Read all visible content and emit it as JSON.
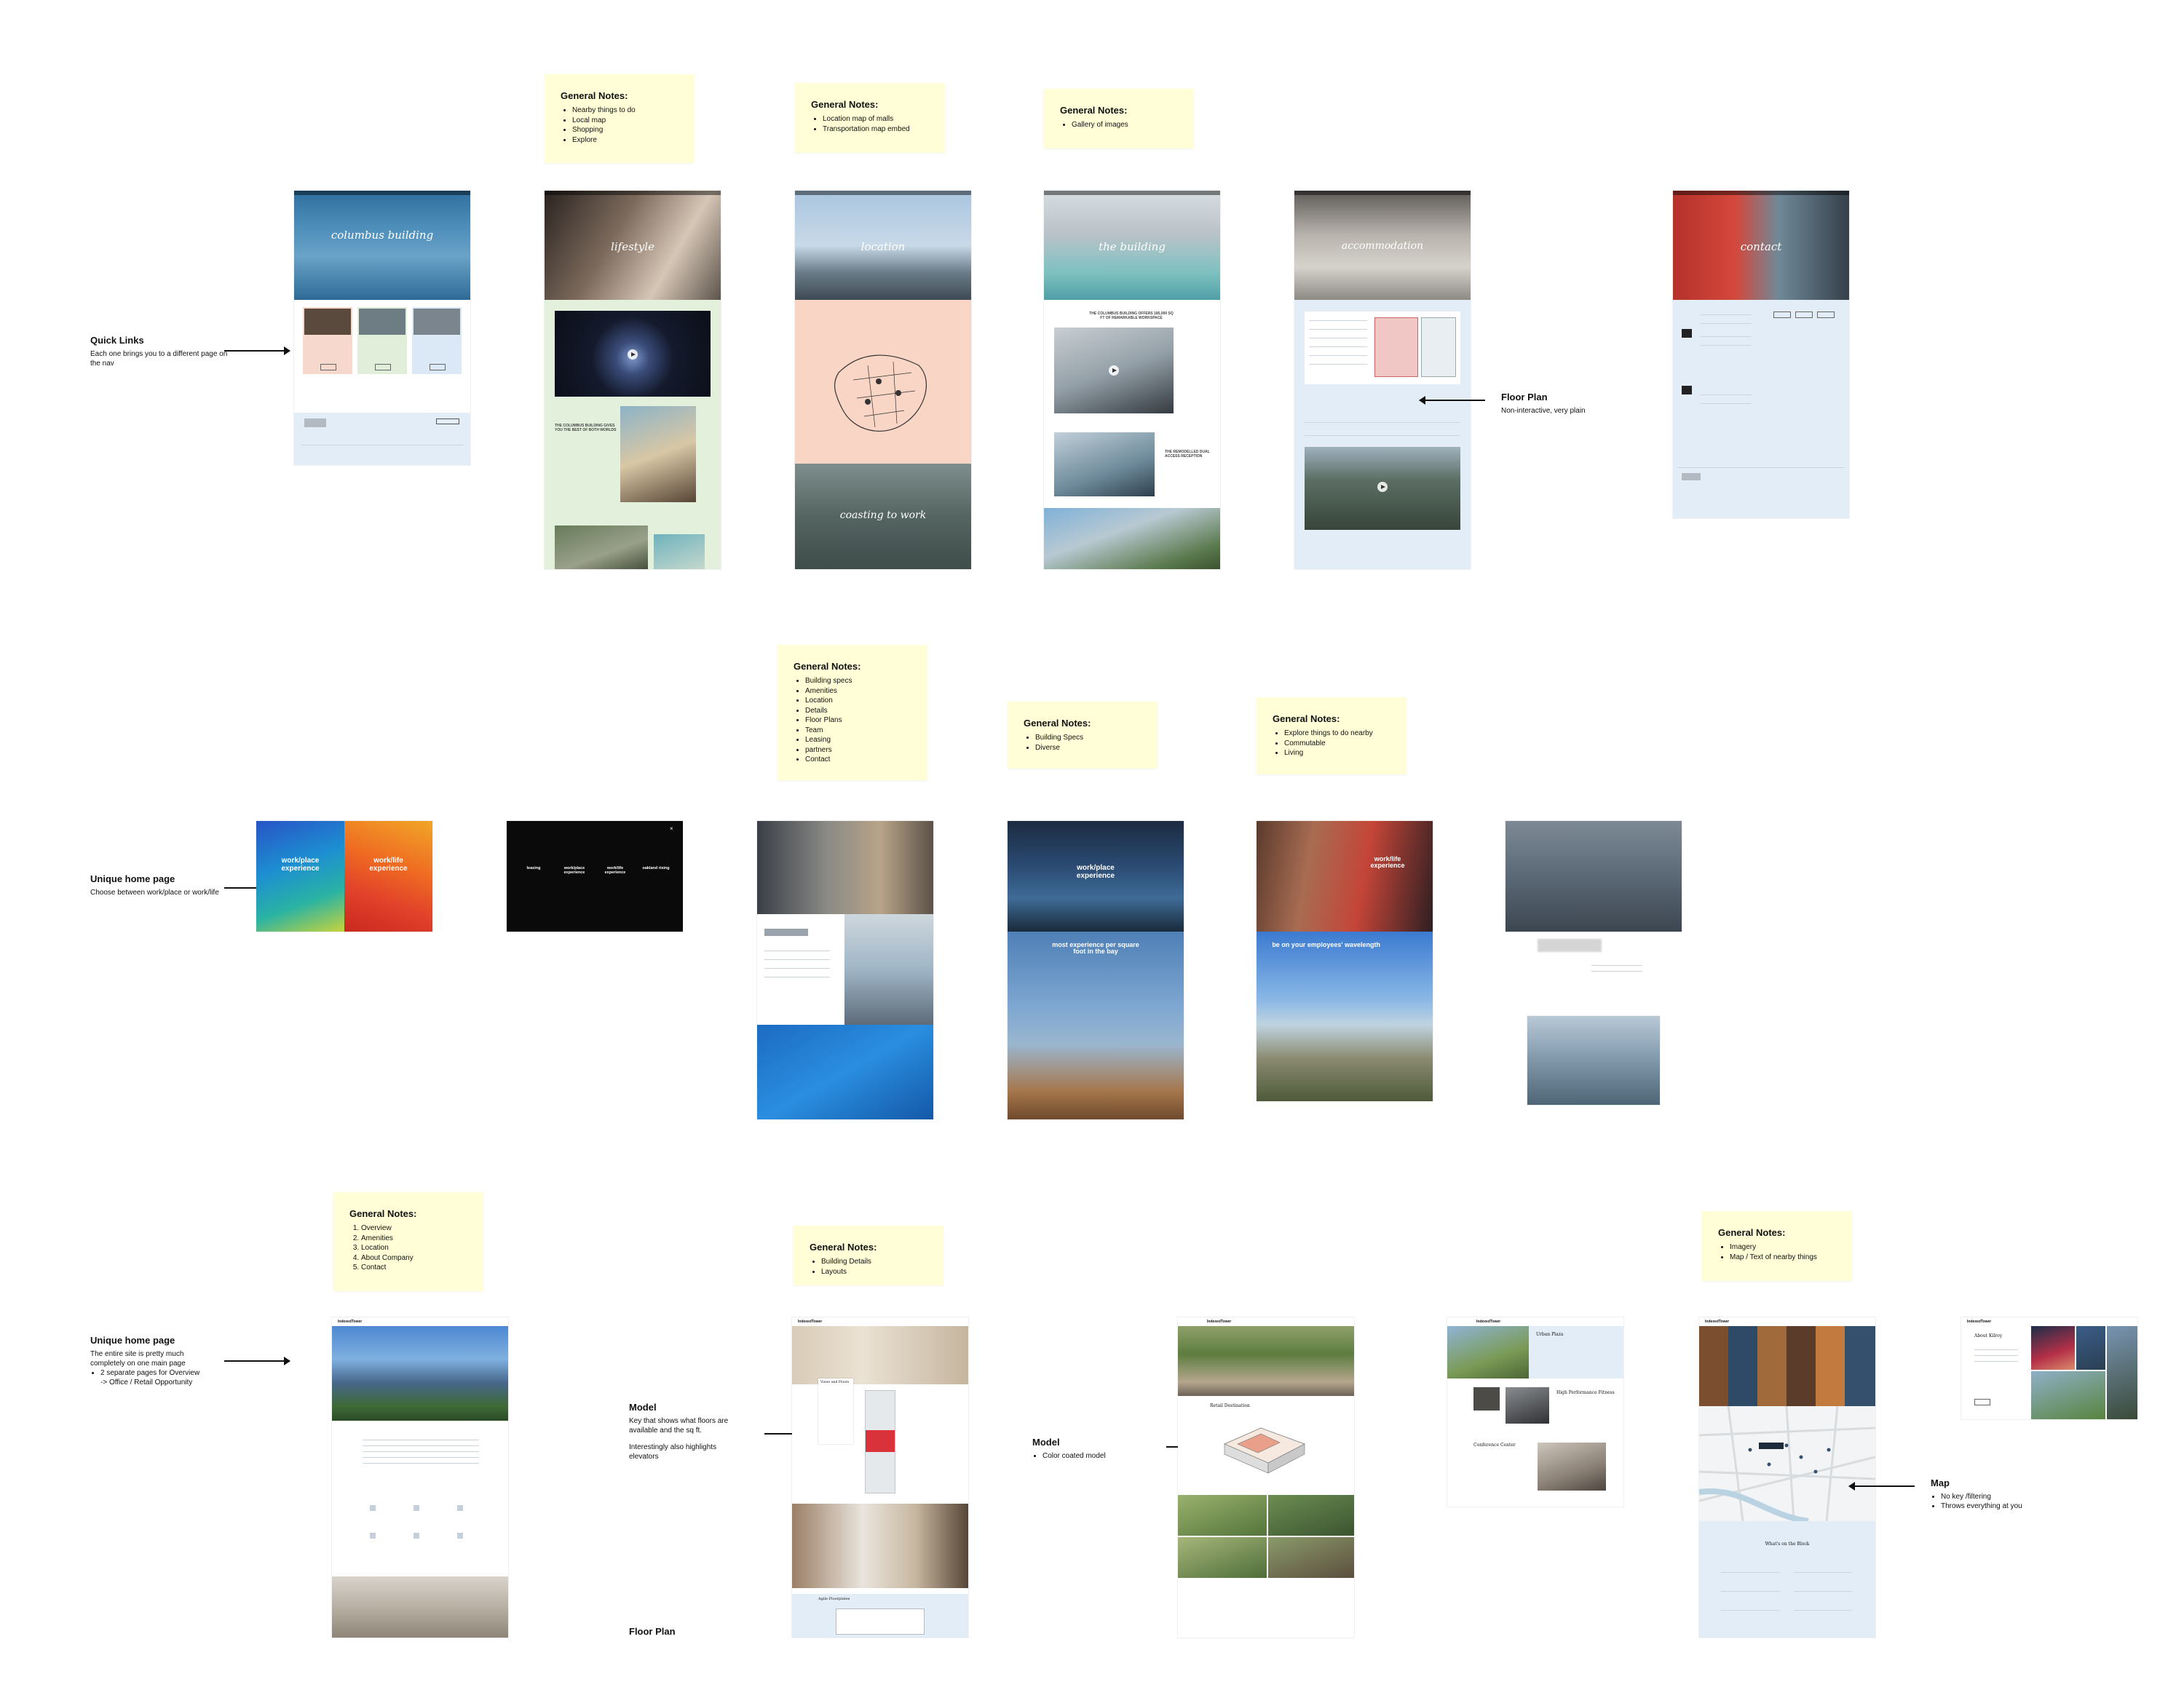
{
  "row1": {
    "notes": [
      {
        "title": "General Notes:",
        "items": [
          "Nearby things to do",
          "Local map",
          "Shopping",
          "Explore"
        ]
      },
      {
        "title": "General Notes:",
        "items": [
          "Location map of malls",
          "Transportation map embed"
        ]
      },
      {
        "title": "General Notes:",
        "items": [
          "Gallery of images"
        ]
      }
    ],
    "annotations": {
      "quick_links": {
        "title": "Quick Links",
        "desc": "Each one brings you to a different page on the nav"
      },
      "floor_plan": {
        "title": "Floor Plan",
        "desc": "Non-interactive, very plain"
      }
    },
    "screens": {
      "home_hero": "columbus building",
      "lifestyle_hero": "lifestyle",
      "location_hero": "location",
      "commute_heading": "coasting to work",
      "building_hero": "the building",
      "accommodation_hero": "accommodation",
      "contact_hero": "contact"
    }
  },
  "row2": {
    "notes": [
      {
        "title": "General Notes:",
        "items": [
          "Building specs",
          "Amenities",
          "Location",
          "Details",
          "Floor Plans",
          "Team",
          "Leasing",
          "partners",
          "Contact"
        ]
      },
      {
        "title": "General Notes:",
        "items": [
          "Building Specs",
          "Diverse"
        ]
      },
      {
        "title": "General Notes:",
        "items": [
          "Explore things to do nearby",
          "Commutable",
          "Living"
        ]
      }
    ],
    "annotations": {
      "unique_home": {
        "title": "Unique home page",
        "desc": "Choose between work/place or work/life"
      }
    },
    "screens": {
      "split_left": "work/place experience",
      "split_right": "work/life experience",
      "dark_menu": [
        "leasing",
        "work/place experience",
        "work/life experience",
        "oakland rising"
      ],
      "workplace_hero": "work/place experience",
      "workplace_sub": "most experience per square foot in the bay",
      "worklife_hero": "work/life experience",
      "worklife_sub": "be on your employees' wavelength"
    }
  },
  "row3": {
    "notes": [
      {
        "title": "General Notes:",
        "items": [
          "Overview",
          "Amenities",
          "Location",
          "About Company",
          "Contact"
        ]
      },
      {
        "title": "General Notes:",
        "items": [
          "Building Details",
          "Layouts"
        ]
      },
      {
        "title": "General Notes:",
        "items": [
          "Imagery",
          "Map / Text of nearby things"
        ]
      }
    ],
    "annotations": {
      "unique_home": {
        "title": "Unique home page",
        "desc": "The entire site is pretty much completely on one main page",
        "bullets": [
          "2 separate pages for Overview",
          "-> Office / Retail Opportunity"
        ]
      },
      "model1": {
        "title": "Model",
        "desc1": "Key that shows what floors are available and the sq ft.",
        "desc2": "Interestingly also highlights elevators"
      },
      "model2": {
        "title": "Model",
        "bullets": [
          "Color coated model"
        ]
      },
      "floor_plan": {
        "title": "Floor Plan"
      },
      "map": {
        "title": "Map",
        "bullets": [
          "No key /filtering",
          "Throws everything at you"
        ]
      }
    },
    "screens": {
      "brand": "IndexedTower",
      "model_panel_title": "Views and Floors",
      "floorplan_title": "Agile Floorplates",
      "retail_title": "Retail Destination",
      "urban_title": "Urban Plaza",
      "perf_title": "High Performance Fitness",
      "conf_title": "Conference Center",
      "block_title": "What's on the Block",
      "about_title": "About Kilroy"
    }
  },
  "colors": {
    "sticky": "#fffed6",
    "pale_blue": "#e3edf7",
    "mint": "#e2f0dc",
    "peach": "#f9d5c5"
  }
}
